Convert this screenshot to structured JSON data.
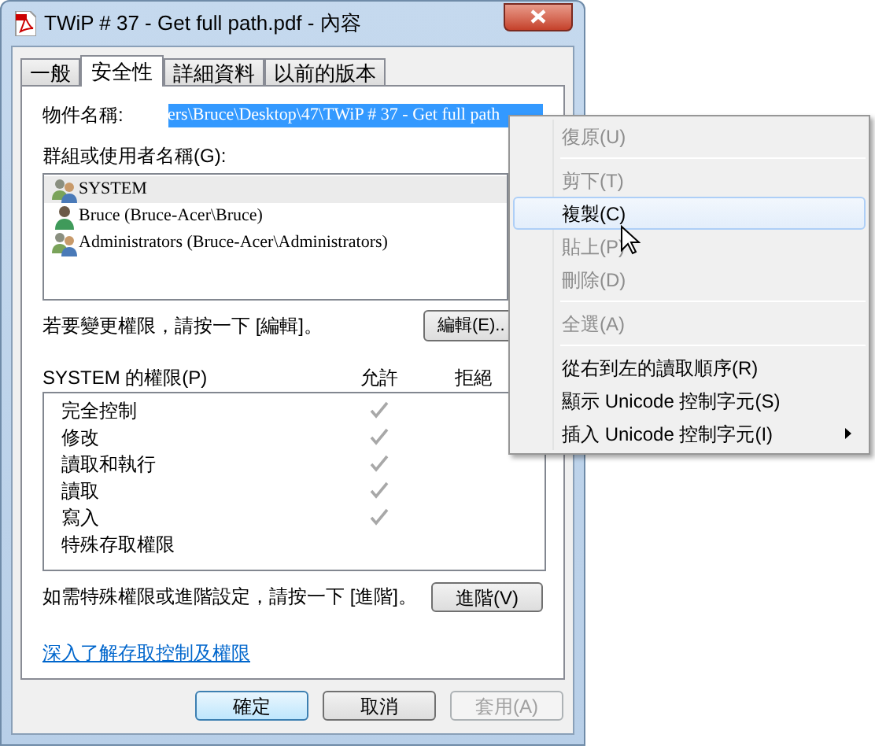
{
  "window": {
    "title": "TWiP # 37 - Get full path.pdf - 內容"
  },
  "tabs": [
    {
      "label": "一般",
      "selected": false
    },
    {
      "label": "安全性",
      "selected": true
    },
    {
      "label": "詳細資料",
      "selected": false
    },
    {
      "label": "以前的版本",
      "selected": false
    }
  ],
  "object_name": {
    "label": "物件名稱:",
    "value": "ers\\Bruce\\Desktop\\47\\TWiP # 37 - Get full path"
  },
  "groups": {
    "label": "群組或使用者名稱(G):",
    "items": [
      {
        "name": "SYSTEM",
        "kind": "group",
        "selected": true
      },
      {
        "name": "Bruce (Bruce-Acer\\Bruce)",
        "kind": "user",
        "selected": false
      },
      {
        "name": "Administrators (Bruce-Acer\\Administrators)",
        "kind": "group",
        "selected": false
      }
    ]
  },
  "edit_hint": "若要變更權限，請按一下 [編輯]。",
  "edit_button": "編輯(E)..",
  "permissions": {
    "title": "SYSTEM 的權限(P)",
    "allow_header": "允許",
    "deny_header": "拒絕",
    "items": [
      {
        "name": "完全控制",
        "allow": true
      },
      {
        "name": "修改",
        "allow": true
      },
      {
        "name": "讀取和執行",
        "allow": true
      },
      {
        "name": "讀取",
        "allow": true
      },
      {
        "name": "寫入",
        "allow": true
      },
      {
        "name": "特殊存取權限",
        "allow": false
      }
    ]
  },
  "advanced_hint": "如需特殊權限或進階設定，請按一下 [進階]。",
  "advanced_button": "進階(V)",
  "link": "深入了解存取控制及權限",
  "buttons": [
    {
      "label": "確定",
      "default": true,
      "disabled": false
    },
    {
      "label": "取消",
      "default": false,
      "disabled": false
    },
    {
      "label": "套用(A)",
      "default": false,
      "disabled": true
    }
  ],
  "context_menu": {
    "items": [
      {
        "kind": "item",
        "label": "復原(U)",
        "disabled": true,
        "selected": false
      },
      {
        "kind": "separator"
      },
      {
        "kind": "item",
        "label": "剪下(T)",
        "disabled": true,
        "selected": false
      },
      {
        "kind": "item",
        "label": "複製(C)",
        "disabled": false,
        "selected": true
      },
      {
        "kind": "item",
        "label": "貼上(P)",
        "disabled": true,
        "selected": false
      },
      {
        "kind": "item",
        "label": "刪除(D)",
        "disabled": true,
        "selected": false
      },
      {
        "kind": "separator"
      },
      {
        "kind": "item",
        "label": "全選(A)",
        "disabled": true,
        "selected": false
      },
      {
        "kind": "separator"
      },
      {
        "kind": "item",
        "label": "從右到左的讀取順序(R)",
        "disabled": false,
        "selected": false
      },
      {
        "kind": "item",
        "label": "顯示 Unicode 控制字元(S)",
        "disabled": false,
        "selected": false
      },
      {
        "kind": "submenu",
        "label": "插入 Unicode 控制字元(I)",
        "disabled": false,
        "selected": false
      }
    ]
  }
}
